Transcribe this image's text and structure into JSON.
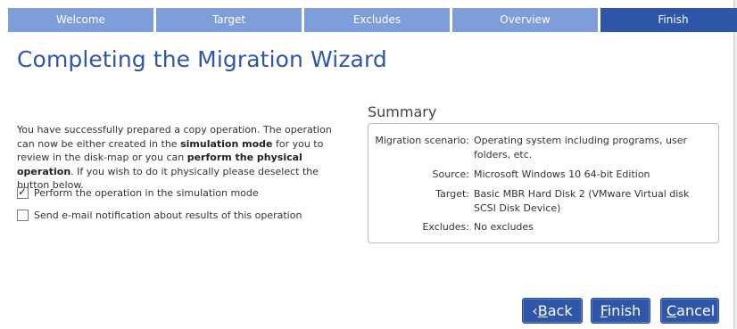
{
  "wizard_steps": [
    {
      "label": "Welcome",
      "active": false
    },
    {
      "label": "Target",
      "active": false
    },
    {
      "label": "Excludes",
      "active": false
    },
    {
      "label": "Overview",
      "active": false
    },
    {
      "label": "Finish",
      "active": true
    }
  ],
  "page_title": "Completing the Migration Wizard",
  "intro": {
    "p1": "You have successfully prepared a copy operation. The operation can now be either created in the ",
    "b1": "simulation mode",
    "p2": " for you to review in the disk-map or you can ",
    "b2": "perform the physical operation",
    "p3": ". If you wish to do it physically please deselect the button below."
  },
  "options": [
    {
      "label": "Perform the operation in the simulation mode",
      "checked": true
    },
    {
      "label": "Send e-mail notification about results of this operation",
      "checked": false
    }
  ],
  "summary": {
    "title": "Summary",
    "rows": [
      {
        "key": "Migration scenario:",
        "value": "Operating system including programs, user folders, etc."
      },
      {
        "key": "Source:",
        "value": "Microsoft Windows 10 64-bit Edition"
      },
      {
        "key": "Target:",
        "value": "Basic MBR Hard Disk 2 (VMware Virtual disk SCSI Disk Device)"
      },
      {
        "key": "Excludes:",
        "value": "No excludes"
      }
    ]
  },
  "buttons": {
    "back": {
      "prefix": "‹",
      "mnemonic": "B",
      "rest": "ack"
    },
    "finish": {
      "mnemonic": "F",
      "rest": "inish"
    },
    "cancel": {
      "mnemonic": "C",
      "rest": "ancel"
    }
  },
  "colors": {
    "step_inactive": "#7d9ed8",
    "step_active": "#2f56a8",
    "accent": "#2f56a8"
  }
}
